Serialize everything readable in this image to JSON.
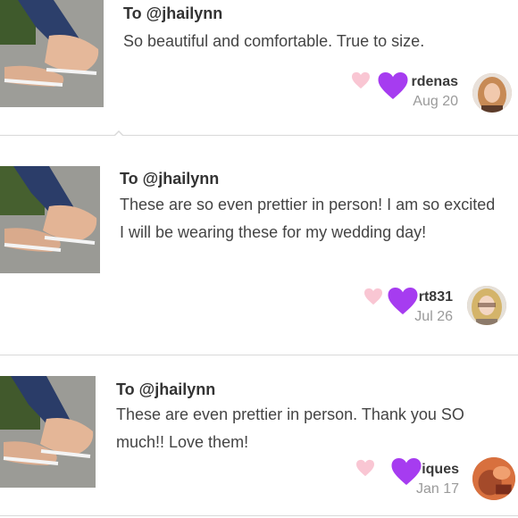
{
  "reviews": [
    {
      "to": "To @jhailynn",
      "text": "So beautiful and comfortable. True to size.",
      "username": "rdenas",
      "date": "Aug 20"
    },
    {
      "to": "To @jhailynn",
      "text": "These are so even prettier in person! I am so excited I will be wearing these for my wedding day!",
      "username": "rt831",
      "date": "Jul 26"
    },
    {
      "to": "To @jhailynn",
      "text": "These are even prettier in person. Thank you SO much!! Love them!",
      "username": "iques",
      "date": "Jan 17"
    }
  ],
  "icons": {
    "like": "heart-icon",
    "overlay": "purple-heart-icon"
  },
  "colors": {
    "like_heart": "#f9c6d3",
    "overlay_heart": "#a63cf0",
    "separator": "#d9d9d9"
  }
}
